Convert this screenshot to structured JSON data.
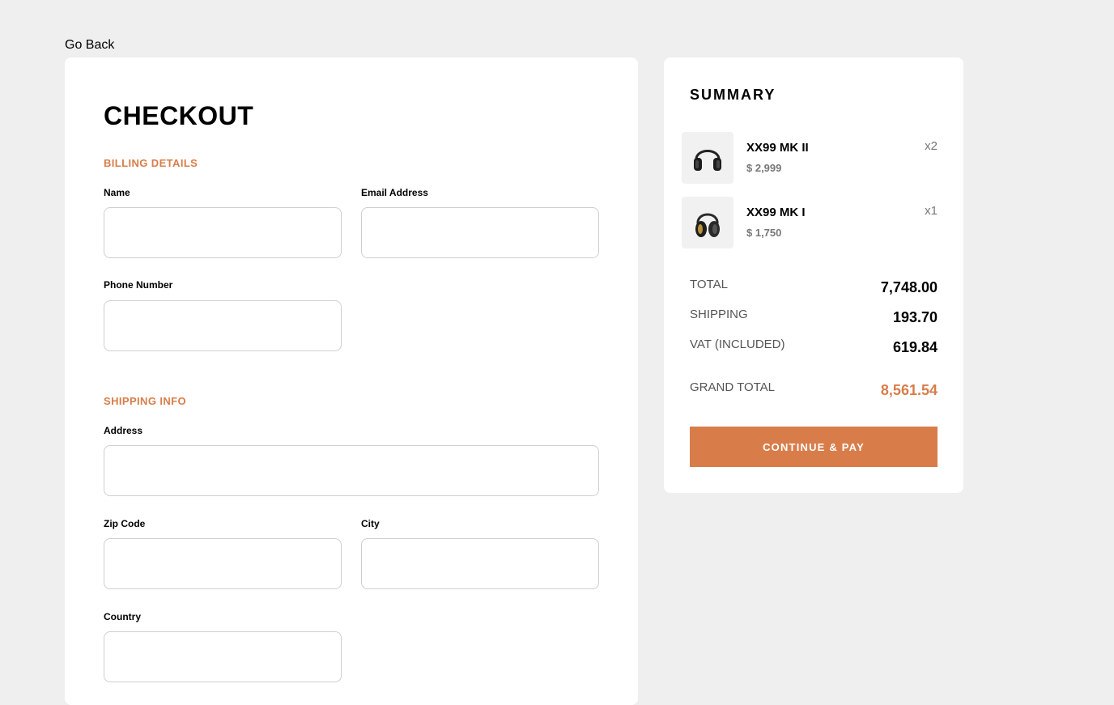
{
  "nav": {
    "go_back": "Go Back"
  },
  "checkout": {
    "title": "CHECKOUT",
    "billing": {
      "title": "BILLING DETAILS",
      "name_label": "Name",
      "name_value": "",
      "email_label": "Email Address",
      "email_value": "",
      "phone_label": "Phone Number",
      "phone_value": ""
    },
    "shipping": {
      "title": "SHIPPING INFO",
      "address_label": "Address",
      "address_value": "",
      "zip_label": "Zip Code",
      "zip_value": "",
      "city_label": "City",
      "city_value": "",
      "country_label": "Country",
      "country_value": ""
    }
  },
  "summary": {
    "title": "SUMMARY",
    "items": [
      {
        "name": "XX99 MK II",
        "price": "$ 2,999",
        "qty": "x2",
        "image": "headphones-icon"
      },
      {
        "name": "XX99 MK I",
        "price": "$ 1,750",
        "qty": "x1",
        "image": "headphones-icon"
      }
    ],
    "total_label": "TOTAL",
    "total_value": "7,748.00",
    "shipping_label": "SHIPPING",
    "shipping_value": "193.70",
    "vat_label": "VAT (INCLUDED)",
    "vat_value": "619.84",
    "grand_total_label": "GRAND TOTAL",
    "grand_total_value": "8,561.54",
    "pay_button": "CONTINUE & PAY"
  },
  "colors": {
    "accent": "#d87d4a",
    "background": "#efefef",
    "card": "#ffffff"
  }
}
